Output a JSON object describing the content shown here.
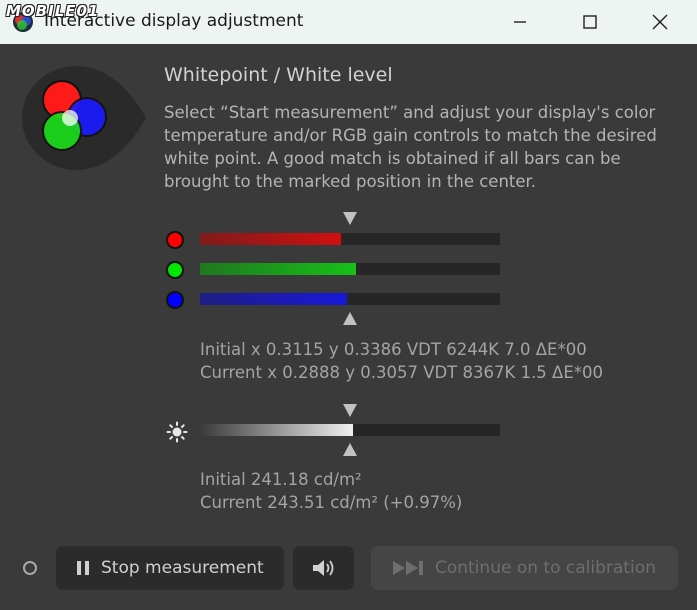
{
  "window": {
    "title": "Interactive display adjustment",
    "watermark": "MOBILE01",
    "controls": {
      "minimize": "minimize-icon",
      "maximize": "maximize-icon",
      "close": "close-icon"
    }
  },
  "header": {
    "heading": "Whitepoint / White level",
    "description": "Select “Start measurement” and adjust your display's color temperature and/or RGB gain controls to match the desired white point. A good match is obtained if all bars can be brought to the marked position in the center."
  },
  "rgb_bars": [
    {
      "channel": "red",
      "color": "#ff0000",
      "bar_color": "#d01010",
      "level": 0.47
    },
    {
      "channel": "green",
      "color": "#00e600",
      "bar_color": "#18c018",
      "level": 0.52
    },
    {
      "channel": "blue",
      "color": "#0000ff",
      "bar_color": "#1818d8",
      "level": 0.49
    }
  ],
  "whitepoint": {
    "initial": "Initial x 0.3115 y 0.3386 VDT 6244K 7.0 ΔE*00",
    "current": "Current x 0.2888 y 0.3057 VDT 8367K 1.5 ΔE*00"
  },
  "luminance_bar": {
    "icon": "brightness-icon",
    "level": 0.51
  },
  "luminance": {
    "initial": "Initial 241.18 cd/m²",
    "current": "Current 243.51 cd/m² (+0.97%)"
  },
  "footer": {
    "stop_label": "Stop measurement",
    "sound_icon": "speaker-icon",
    "continue_label": "Continue on to calibration"
  }
}
